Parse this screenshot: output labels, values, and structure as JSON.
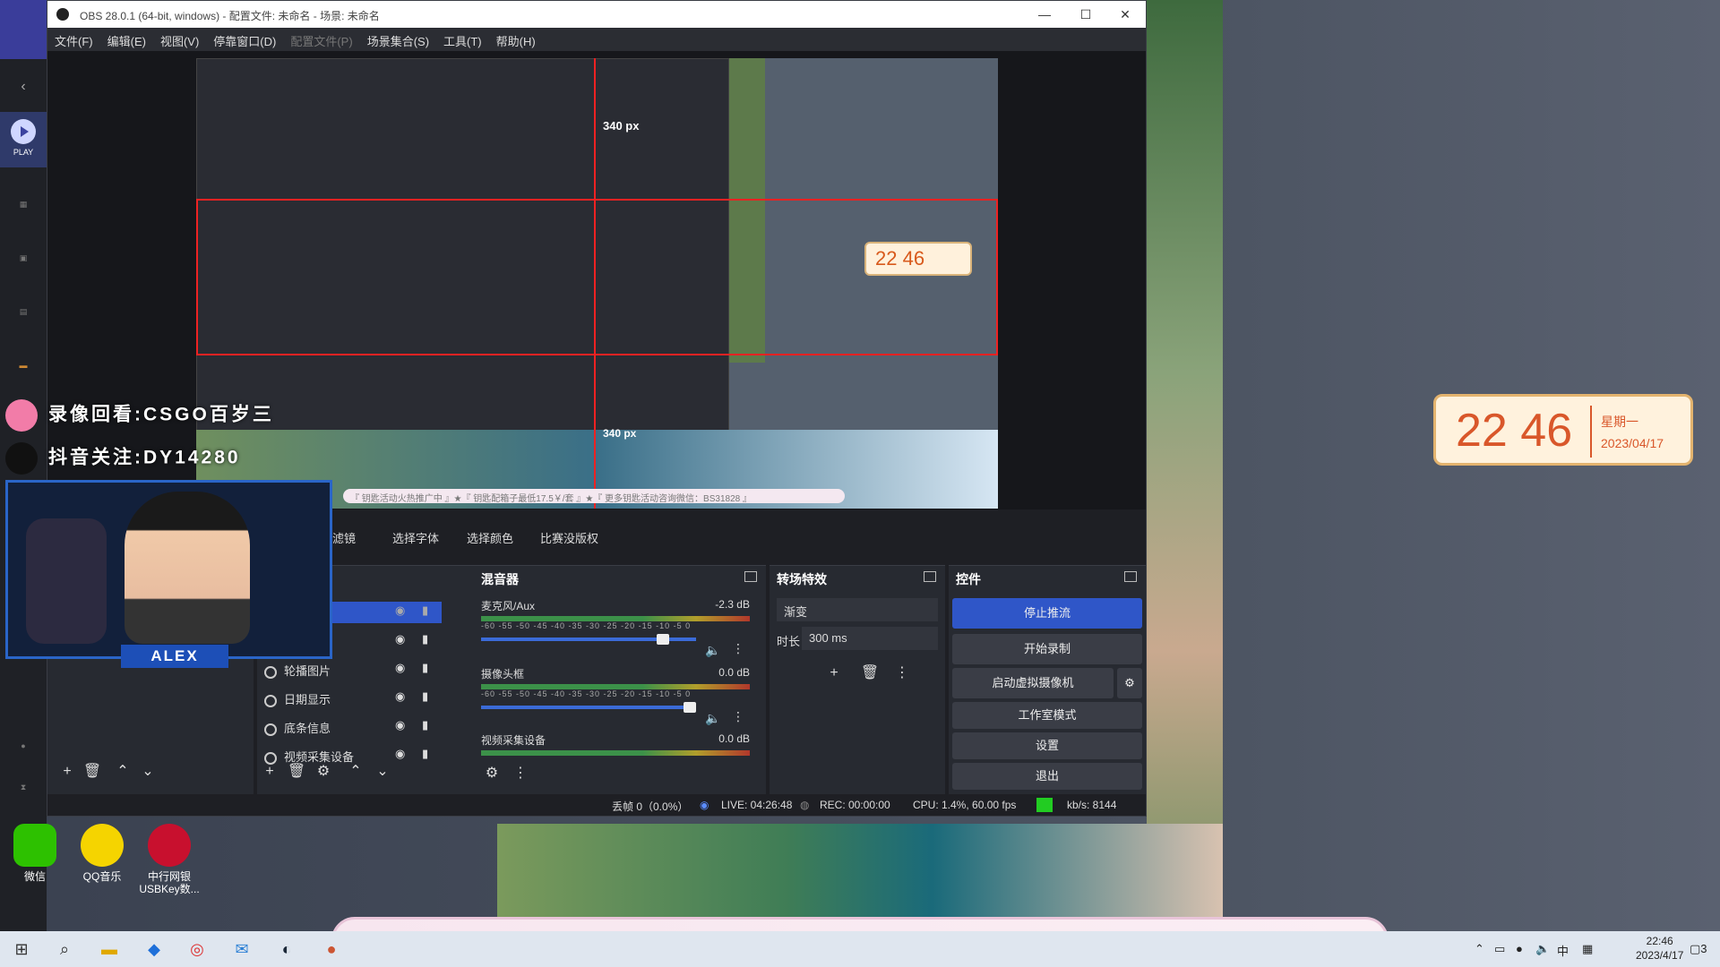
{
  "window": {
    "title": "OBS 28.0.1 (64-bit, windows) - 配置文件: 未命名 - 场景: 未命名",
    "min": "—",
    "max": "☐",
    "close": "✕"
  },
  "menu": [
    "文件(F)",
    "编辑(E)",
    "视图(V)",
    "停靠窗口(D)",
    "配置文件(P)",
    "场景集合(S)",
    "工具(T)",
    "帮助(H)"
  ],
  "leftapp": {
    "play": "PLAY"
  },
  "preview": {
    "px_label_top": "340 px",
    "px_label_bottom": "340 px",
    "clock_small": "22 46"
  },
  "overlay": {
    "bili_text": "录像回看:CSGO百岁三",
    "dy_text": "抖音关注:DY14280",
    "name": "ALEX"
  },
  "filterbar": [
    "滤镜",
    "选择字体",
    "选择颜色",
    "比赛没版权"
  ],
  "sources": {
    "items": [
      {
        "label": "框"
      },
      {
        "label": "轮播图片"
      },
      {
        "label": "日期显示"
      },
      {
        "label": "底条信息"
      },
      {
        "label": "视频采集设备"
      }
    ]
  },
  "mixer": {
    "title": "混音器",
    "channels": [
      {
        "name": "麦克风/Aux",
        "db": "-2.3 dB",
        "level": 0.58
      },
      {
        "name": "摄像头框",
        "db": "0.0 dB",
        "level": 1.0
      },
      {
        "name": "视频采集设备",
        "db": "0.0 dB",
        "level": 1.0
      }
    ],
    "scale": "-60 -55 -50 -45 -40 -35 -30 -25 -20 -15 -10 -5 0"
  },
  "transitions": {
    "title": "转场特效",
    "type": "渐变",
    "duration_label": "时长",
    "duration": "300 ms"
  },
  "controls": {
    "title": "控件",
    "buttons": [
      "停止推流",
      "开始录制",
      "启动虚拟摄像机",
      "工作室模式",
      "设置",
      "退出"
    ]
  },
  "status": {
    "dropped": "丢帧 0（0.0%）",
    "live": "LIVE: 04:26:48",
    "rec": "REC: 00:00:00",
    "cpu": "CPU: 1.4%, 60.00 fps",
    "kbs": "kb/s: 8144"
  },
  "desktop_icons": [
    {
      "label": "微信"
    },
    {
      "label": "QQ音乐"
    },
    {
      "label": "中行网银\nUSBKey数..."
    }
  ],
  "clock": {
    "time": "22 46",
    "day": "星期一",
    "date": "2023/04/17"
  },
  "ticker": "『 钥匙活动火热推广中 』★『 钥匙配箱子最低17.5￥/套 』★『 更多钥匙活动咨询微信：BS31828 』",
  "ticker_small": "『 钥匙活动火热推广中 』★『 钥匙配箱子最低17.5￥/套 』★『 更多钥匙活动咨询微信：BS31828 』",
  "taskbar": {
    "time": "22:46",
    "date": "2023/4/17",
    "ime": "中",
    "notif": "3"
  },
  "colors": {
    "accent": "#2f56c8",
    "live_green": "#22cc22",
    "clock_orange": "#d9572a"
  }
}
